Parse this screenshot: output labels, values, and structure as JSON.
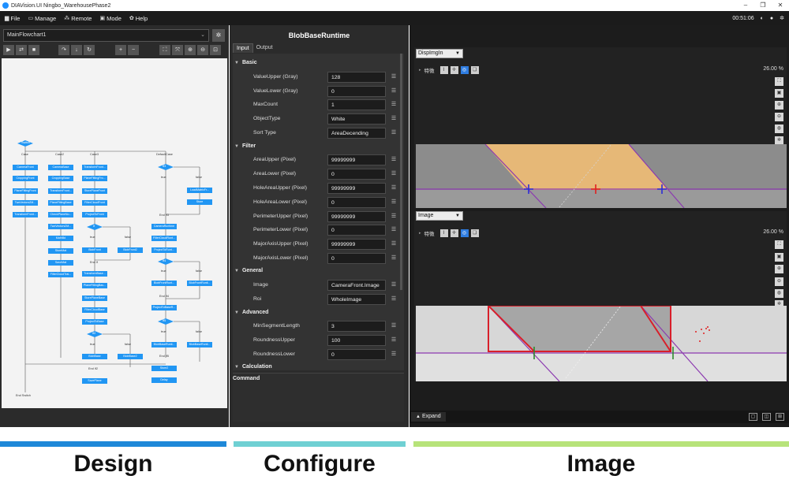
{
  "titlebar": {
    "title": "DIAVision.UI Ningbo_WarehousePhase2"
  },
  "menubar": {
    "items": [
      {
        "icon": "file-icon",
        "label": "File"
      },
      {
        "icon": "monitor-icon",
        "label": "Manage"
      },
      {
        "icon": "remote-icon",
        "label": "Remote"
      },
      {
        "icon": "mode-icon",
        "label": "Mode"
      },
      {
        "icon": "gear-icon",
        "label": "Help"
      }
    ],
    "clock": "00:51:06"
  },
  "design": {
    "flowchart_name": "MainFlowchart1",
    "nodes": {
      "switch": "Switch",
      "case_labels": [
        "Case",
        "Case2",
        "Case3",
        "DefaultCase"
      ],
      "col1": [
        "CameraFront",
        "CroppingFront",
        "PlaneFittingFront",
        "TwoVectors2M...",
        "TransformFront..."
      ],
      "col2": [
        "CameraBase",
        "CroppingBase",
        "TransformFront...",
        "PlaneFittingBase",
        "CheckPlaneNo...",
        "TwoVectors2M...",
        "MathBd",
        "StoreMat",
        "SaveMat",
        "FilterCloudTrai..."
      ],
      "col3": [
        "TransformFront...",
        "PlaneFittingFro...",
        "StorePlaneFront",
        "FilterCloudFront",
        "ProjectToFront",
        "BlobFront",
        "TransformBase...",
        "PlaneFittingBas...",
        "StorePlaneBase",
        "FilterCloudBase",
        "ProjectToBase",
        "BlobBase",
        "SavePlane"
      ],
      "col3b": [
        "BlobFront2",
        "BlobBase2"
      ],
      "col4": [
        "LoadMatrixFr...",
        "Store",
        "CameraRuntime",
        "FilterCloudRunt...",
        "ProjectToRunt...",
        "BlobFrontRunt...",
        "ProjectToBaseR...",
        "BlobBaseRunti...",
        "Store2",
        "Delay"
      ],
      "col4b": [
        "BlobFrontRunti...",
        "BlobBaseRunti..."
      ],
      "decisions": [
        "If3",
        "If",
        "If4",
        "If2",
        "If5"
      ],
      "labels": {
        "true": "true",
        "false": "false",
        "end_if3": "End If3",
        "end_if": "End If",
        "end_if4": "End If4",
        "end_if2": "End If2",
        "end_if5": "End If5",
        "end_switch": "End Switch"
      }
    }
  },
  "configure": {
    "title": "BlobBaseRuntime",
    "tabs": [
      "Input",
      "Output"
    ],
    "sections": {
      "basic": "Basic",
      "filter": "Filter",
      "general": "General",
      "advanced": "Advanced",
      "calculation": "Calculation"
    },
    "basic": [
      {
        "label": "ValueUpper (Gray)",
        "value": "128"
      },
      {
        "label": "ValueLower (Gray)",
        "value": "0"
      },
      {
        "label": "MaxCount",
        "value": "1"
      },
      {
        "label": "ObjectType",
        "value": "White"
      },
      {
        "label": "Sort Type",
        "value": "AreaDecending"
      }
    ],
    "filter": [
      {
        "label": "AreaUpper (Pixel)",
        "value": "99999999"
      },
      {
        "label": "AreaLower (Pixel)",
        "value": "0"
      },
      {
        "label": "HoleAreaUpper (Pixel)",
        "value": "99999999"
      },
      {
        "label": "HoleAreaLower (Pixel)",
        "value": "0"
      },
      {
        "label": "PerimeterUpper (Pixel)",
        "value": "99999999"
      },
      {
        "label": "PerimeterLower (Pixel)",
        "value": "0"
      },
      {
        "label": "MajorAxisUpper (Pixel)",
        "value": "99999999"
      },
      {
        "label": "MajorAxisLower (Pixel)",
        "value": "0"
      }
    ],
    "general": [
      {
        "label": "Image",
        "value": "CameraFront.Image"
      },
      {
        "label": "Roi",
        "value": "WholeImage"
      }
    ],
    "advanced": [
      {
        "label": "MinSegmentLength",
        "value": "3"
      },
      {
        "label": "RoundnessUpper",
        "value": "100"
      },
      {
        "label": "RoundnessLower",
        "value": "0"
      }
    ],
    "command_label": "Command"
  },
  "image": {
    "viewer1": {
      "source": "DispImgIn",
      "feature_label": "特徴",
      "zoom": "26.00 %"
    },
    "viewer2": {
      "source": "Image",
      "feature_label": "特徴",
      "zoom": "26.00 %"
    },
    "expand_label": "Expand"
  },
  "captions": {
    "design": "Design",
    "configure": "Configure",
    "image": "Image"
  },
  "colors": {
    "design": "#1e88d8",
    "configure": "#6fd0d3",
    "image": "#b7e37a",
    "node": "#2196f3"
  }
}
